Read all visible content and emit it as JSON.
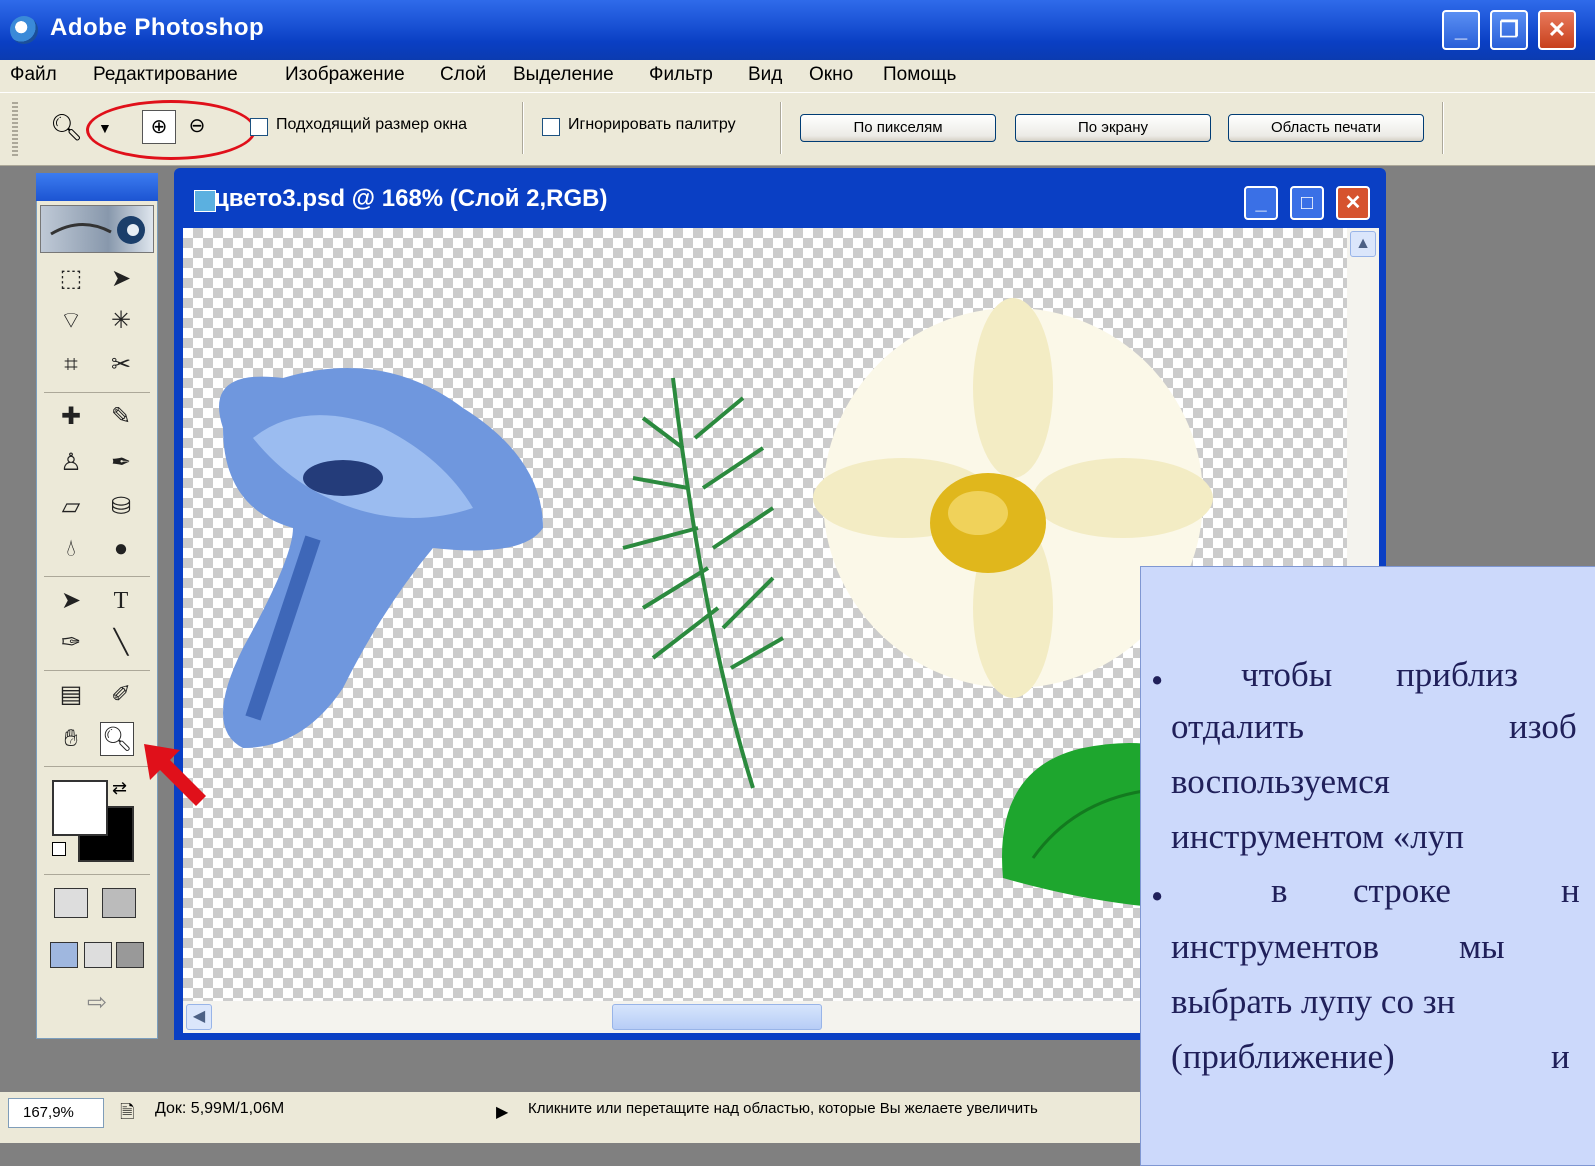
{
  "window": {
    "title": "Adobe Photoshop"
  },
  "menu": [
    "Файл",
    "Редактирование",
    "Изображение",
    "Слой",
    "Выделение",
    "Фильтр",
    "Вид",
    "Окно",
    "Помощь"
  ],
  "options": {
    "fit_window_label": "Подходящий размер окна",
    "ignore_palettes_label": "Игнорировать палитру",
    "actual_pixels": "По пикселям",
    "fit_screen": "По экрану",
    "print_size": "Область печати"
  },
  "document": {
    "title": "цвето3.psd @ 168% (Слой 2,RGB)"
  },
  "tools": {
    "icons": [
      "marquee-icon",
      "move-icon",
      "lasso-icon",
      "magic-wand-icon",
      "crop-icon",
      "slice-icon",
      "healing-brush-icon",
      "brush-icon",
      "stamp-icon",
      "history-brush-icon",
      "eraser-icon",
      "paint-bucket-icon",
      "blur-icon",
      "dodge-icon",
      "path-select-icon",
      "type-icon",
      "pen-icon",
      "line-icon",
      "notes-icon",
      "eyedropper-icon",
      "hand-icon",
      "zoom-icon"
    ],
    "type_glyph": "T"
  },
  "status": {
    "zoom": "167,9%",
    "doc": "Док: 5,99М/1,06М",
    "hint": "Кликните или перетащите над областью, которые Вы желаете увеличить"
  },
  "callout": {
    "lines": [
      "•",
      "чтобы",
      "приблиз",
      "отдалить",
      "изоб",
      "воспользуемся",
      "инструментом «луп",
      "•",
      "в",
      "строке",
      "н",
      "инструментов",
      "мы",
      "выбрать лупу со зн",
      "(приближение)",
      "и"
    ]
  },
  "colors": {
    "title_blue": "#0a3fc4",
    "callout_bg": "#ccd9fb",
    "highlight_red": "#e0101a"
  }
}
